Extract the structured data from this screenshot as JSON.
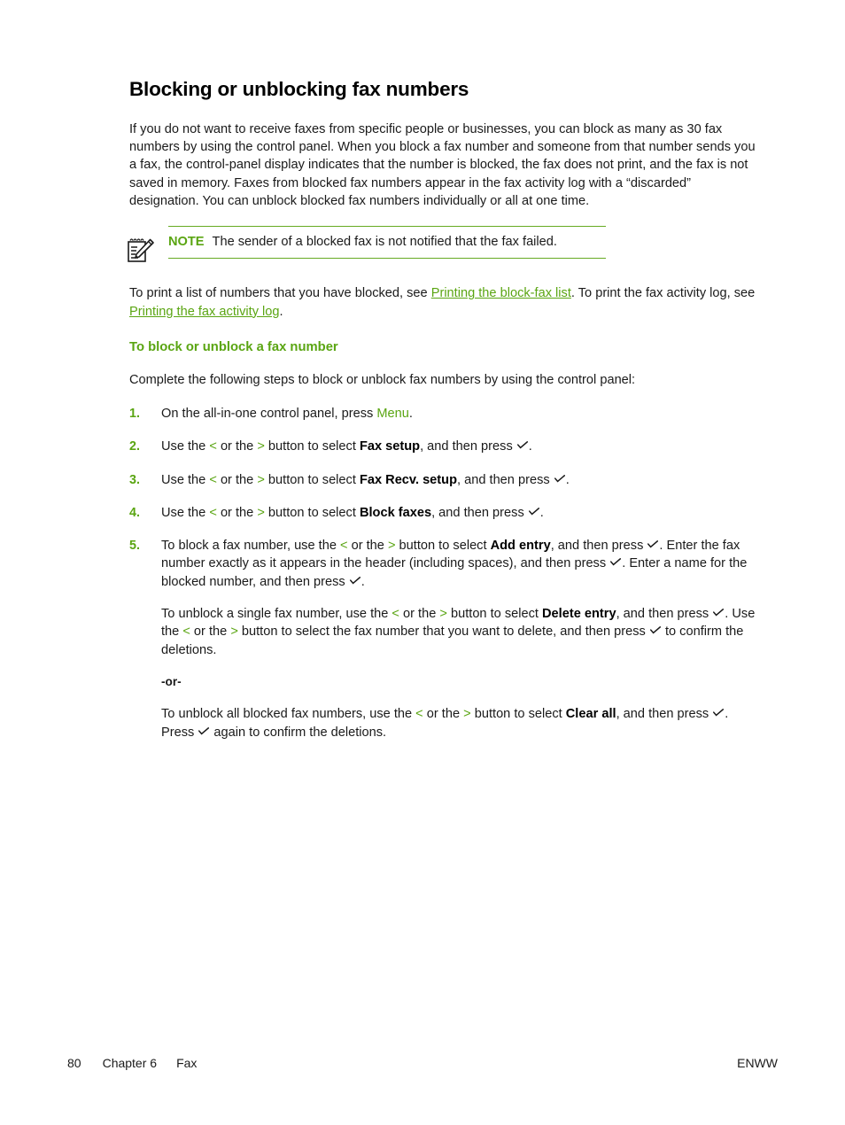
{
  "document": {
    "title": "Blocking or unblocking fax numbers",
    "intro_paragraph": "If you do not want to receive faxes from specific people or businesses, you can block as many as 30 fax numbers by using the control panel. When you block a fax number and someone from that number sends you a fax, the control-panel display indicates that the number is blocked, the fax does not print, and the fax is not saved in memory. Faxes from blocked fax numbers appear in the fax activity log with a “discarded” designation. You can unblock blocked fax numbers individually or all at one time."
  },
  "note": {
    "icon": "notepad-pencil-icon",
    "label": "NOTE",
    "text": "The sender of a blocked fax is not notified that the fax failed.",
    "rule_color": "#66aa22"
  },
  "links_paragraph": {
    "text_1": "To print a list of numbers that you have blocked, see ",
    "link_1": "Printing the block-fax list",
    "text_2": ". To print the fax activity log, see ",
    "link_2": "Printing the fax activity log",
    "text_3": "."
  },
  "section": {
    "heading": "To block or unblock a fax number",
    "intro": "Complete the following steps to block or unblock fax numbers by using the control panel:"
  },
  "steps": [
    {
      "number": "1.",
      "parts": [
        {
          "t": "text",
          "v": "On the all-in-one control panel, press "
        },
        {
          "t": "green",
          "v": "Menu"
        },
        {
          "t": "text",
          "v": "."
        }
      ]
    },
    {
      "number": "2.",
      "parts": [
        {
          "t": "text",
          "v": "Use the "
        },
        {
          "t": "green",
          "v": "<"
        },
        {
          "t": "text",
          "v": " or the "
        },
        {
          "t": "green",
          "v": ">"
        },
        {
          "t": "text",
          "v": " button to select "
        },
        {
          "t": "bold",
          "v": "Fax setup"
        },
        {
          "t": "text",
          "v": ", and then press "
        },
        {
          "t": "check",
          "v": "✓"
        },
        {
          "t": "text",
          "v": "."
        }
      ]
    },
    {
      "number": "3.",
      "parts": [
        {
          "t": "text",
          "v": "Use the "
        },
        {
          "t": "green",
          "v": "<"
        },
        {
          "t": "text",
          "v": " or the "
        },
        {
          "t": "green",
          "v": ">"
        },
        {
          "t": "text",
          "v": " button to select "
        },
        {
          "t": "bold",
          "v": "Fax Recv. setup"
        },
        {
          "t": "text",
          "v": ", and then press "
        },
        {
          "t": "check",
          "v": "✓"
        },
        {
          "t": "text",
          "v": "."
        }
      ]
    },
    {
      "number": "4.",
      "parts": [
        {
          "t": "text",
          "v": "Use the "
        },
        {
          "t": "green",
          "v": "<"
        },
        {
          "t": "text",
          "v": " or the "
        },
        {
          "t": "green",
          "v": ">"
        },
        {
          "t": "text",
          "v": " button to select "
        },
        {
          "t": "bold",
          "v": "Block faxes"
        },
        {
          "t": "text",
          "v": ", and then press "
        },
        {
          "t": "check",
          "v": "✓"
        },
        {
          "t": "text",
          "v": "."
        }
      ]
    },
    {
      "number": "5.",
      "paragraphs": [
        {
          "style": "normal",
          "parts": [
            {
              "t": "text",
              "v": "To block a fax number, use the "
            },
            {
              "t": "green",
              "v": "<"
            },
            {
              "t": "text",
              "v": " or the "
            },
            {
              "t": "green",
              "v": ">"
            },
            {
              "t": "text",
              "v": " button to select "
            },
            {
              "t": "bold",
              "v": "Add entry"
            },
            {
              "t": "text",
              "v": ", and then press "
            },
            {
              "t": "check",
              "v": "✓"
            },
            {
              "t": "text",
              "v": ". Enter the fax number exactly as it appears in the header (including spaces), and then press "
            },
            {
              "t": "check",
              "v": "✓"
            },
            {
              "t": "text",
              "v": ". Enter a name for the blocked number, and then press "
            },
            {
              "t": "check",
              "v": "✓"
            },
            {
              "t": "text",
              "v": "."
            }
          ]
        },
        {
          "style": "normal",
          "parts": [
            {
              "t": "text",
              "v": "To unblock a single fax number, use the "
            },
            {
              "t": "green",
              "v": "<"
            },
            {
              "t": "text",
              "v": " or the "
            },
            {
              "t": "green",
              "v": ">"
            },
            {
              "t": "text",
              "v": " button to select "
            },
            {
              "t": "bold",
              "v": "Delete entry"
            },
            {
              "t": "text",
              "v": ", and then press "
            },
            {
              "t": "check",
              "v": "✓"
            },
            {
              "t": "text",
              "v": ". Use the "
            },
            {
              "t": "green",
              "v": "<"
            },
            {
              "t": "text",
              "v": " or the "
            },
            {
              "t": "green",
              "v": ">"
            },
            {
              "t": "text",
              "v": " button to select the fax number that you want to delete, and then press "
            },
            {
              "t": "check",
              "v": "✓"
            },
            {
              "t": "text",
              "v": " to confirm the deletions."
            }
          ]
        },
        {
          "style": "or-label",
          "parts": [
            {
              "t": "text",
              "v": "-or-"
            }
          ]
        },
        {
          "style": "normal",
          "parts": [
            {
              "t": "text",
              "v": "To unblock all blocked fax numbers, use the "
            },
            {
              "t": "green",
              "v": "<"
            },
            {
              "t": "text",
              "v": " or the "
            },
            {
              "t": "green",
              "v": ">"
            },
            {
              "t": "text",
              "v": " button to select "
            },
            {
              "t": "bold",
              "v": "Clear all"
            },
            {
              "t": "text",
              "v": ", and then press "
            },
            {
              "t": "check",
              "v": "✓"
            },
            {
              "t": "text",
              "v": ". Press "
            },
            {
              "t": "check",
              "v": "✓"
            },
            {
              "t": "text",
              "v": " again to confirm the deletions."
            }
          ]
        }
      ]
    }
  ],
  "footer": {
    "page_number": "80",
    "chapter": "Chapter 6",
    "chapter_title": "Fax",
    "locale": "ENWW"
  },
  "colors": {
    "accent_green": "#5aa512",
    "rule_green": "#66aa22",
    "body_text": "#1a1a1a"
  }
}
